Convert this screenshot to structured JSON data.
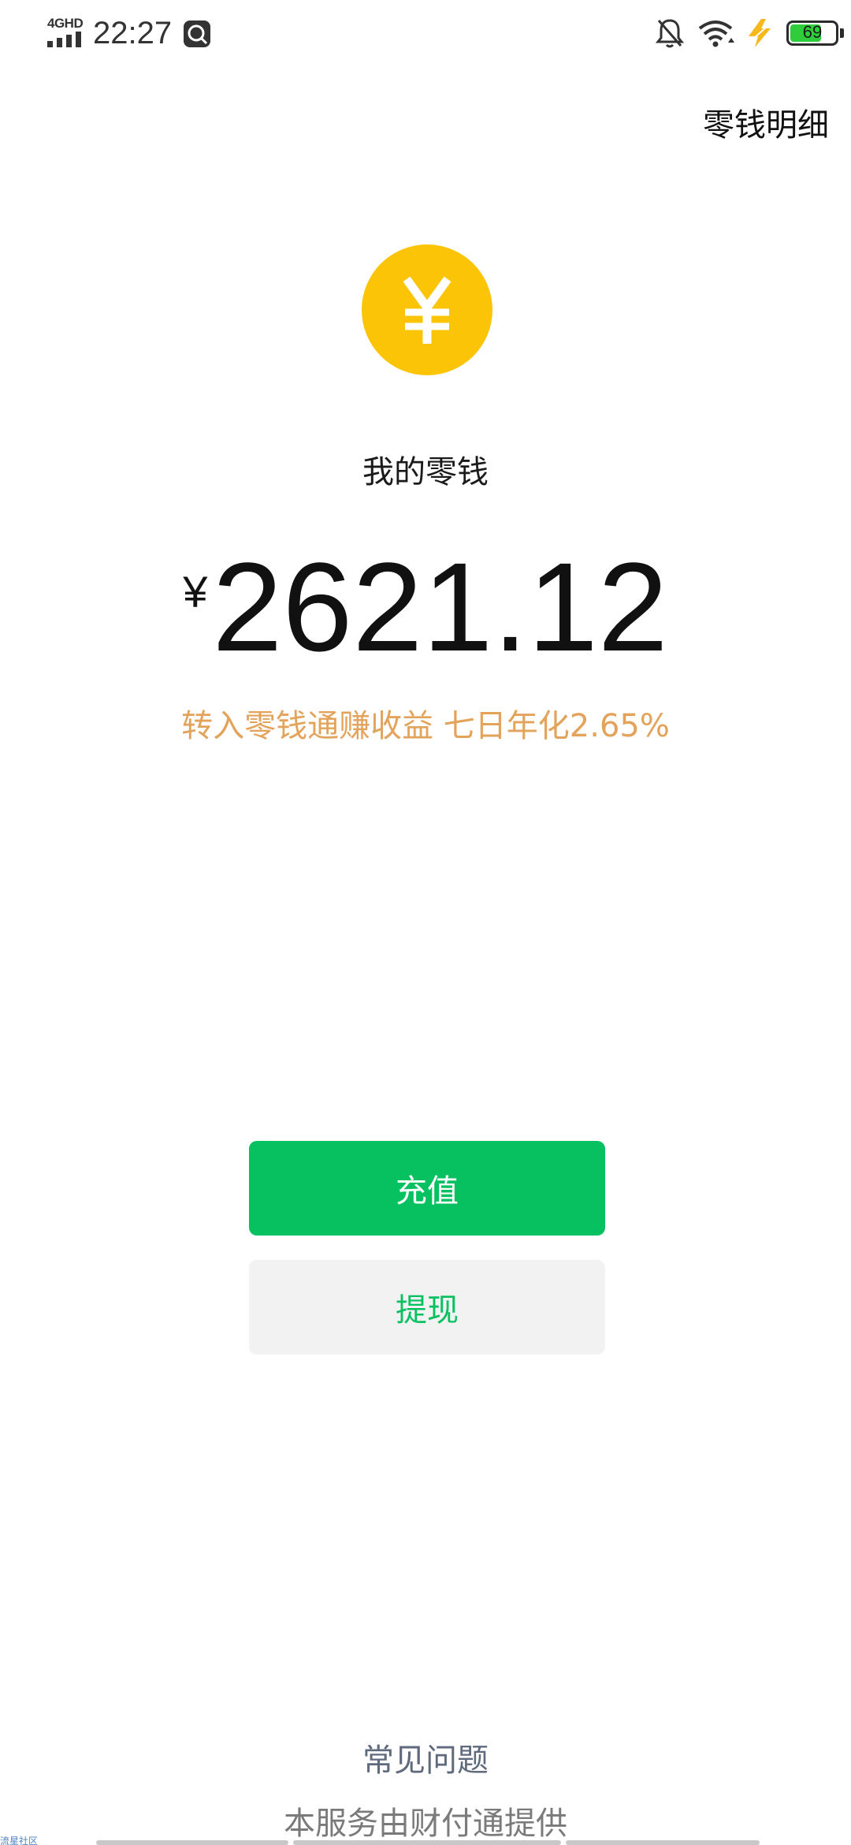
{
  "status_bar": {
    "network_type": "4GHD",
    "time": "22:27",
    "battery_level": "69",
    "battery_fraction": 0.69,
    "icons": [
      "signal-icon",
      "app-notification-icon",
      "mute-icon",
      "wifi-icon",
      "charging-icon",
      "battery-icon"
    ]
  },
  "header": {
    "detail_link": "零钱明细"
  },
  "wallet": {
    "coin_icon": "yuan-coin-icon",
    "coin_color": "#fbc407",
    "title": "我的零钱",
    "currency_symbol": "¥",
    "balance": "2621.12",
    "yield_promo": "转入零钱通赚收益 七日年化2.65%",
    "promo_color": "#e3a35a"
  },
  "actions": {
    "topup_label": "充值",
    "withdraw_label": "提现",
    "accent_color": "#07c160"
  },
  "footer": {
    "faq_link": "常见问题",
    "provider_note": "本服务由财付通提供",
    "watermark": "流星社区"
  }
}
